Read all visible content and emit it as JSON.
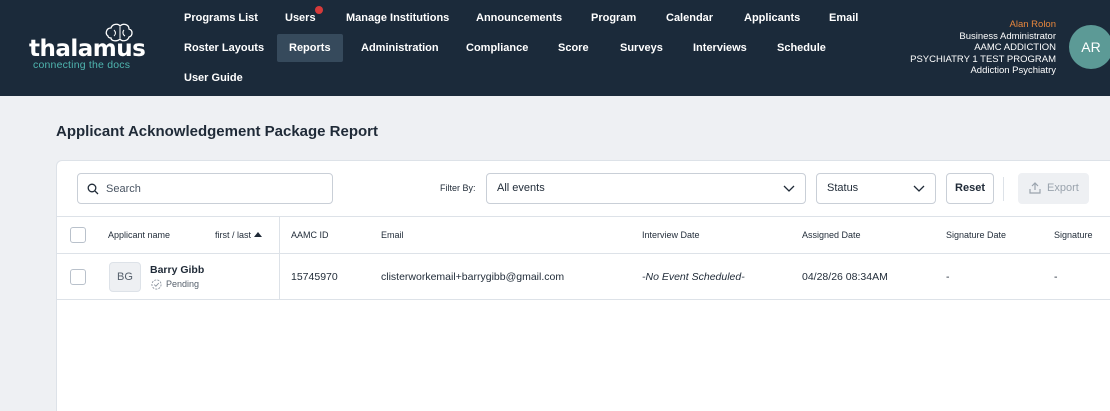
{
  "header": {
    "logo_text": "thalamus",
    "tagline": "connecting the docs",
    "nav": [
      {
        "label": "Programs List"
      },
      {
        "label": "Users"
      },
      {
        "label": "Manage Institutions"
      },
      {
        "label": "Announcements"
      },
      {
        "label": "Program"
      },
      {
        "label": "Calendar"
      },
      {
        "label": "Applicants"
      },
      {
        "label": "Email"
      },
      {
        "label": "Roster Layouts"
      },
      {
        "label": "Reports"
      },
      {
        "label": "Administration"
      },
      {
        "label": "Compliance"
      },
      {
        "label": "Score"
      },
      {
        "label": "Surveys"
      },
      {
        "label": "Interviews"
      },
      {
        "label": "Schedule"
      },
      {
        "label": "User Guide"
      }
    ],
    "active_nav": "Reports",
    "user": {
      "name": "Alan Rolon",
      "role": "Business Administrator",
      "program_line1": "AAMC ADDICTION",
      "program_line2": "PSYCHIATRY 1 TEST PROGRAM",
      "specialty": "Addiction Psychiatry",
      "initials": "AR"
    }
  },
  "page": {
    "title": "Applicant Acknowledgement Package Report"
  },
  "toolbar": {
    "search_placeholder": "Search",
    "filter_label": "Filter By:",
    "events_selected": "All events",
    "status_selected": "Status",
    "reset_label": "Reset",
    "export_label": "Export"
  },
  "table": {
    "columns": {
      "applicant_name": "Applicant name",
      "sort_label": "first / last",
      "aamc_id": "AAMC ID",
      "email": "Email",
      "interview_date": "Interview Date",
      "assigned_date": "Assigned Date",
      "signature_date": "Signature Date",
      "signature": "Signature"
    },
    "rows": [
      {
        "initials": "BG",
        "name": "Barry Gibb",
        "status": "Pending",
        "aamc_id": "15745970",
        "email": "clisterworkemail+barrygibb@gmail.com",
        "interview_date": "-No Event Scheduled-",
        "assigned_date": "04/28/26 08:34AM",
        "signature_date": "-",
        "signature": "-"
      }
    ]
  },
  "colors": {
    "header_bg": "#1b2a3a",
    "accent_teal": "#4fb6b0",
    "user_name": "#e8873d",
    "notification": "#d63a3a"
  }
}
